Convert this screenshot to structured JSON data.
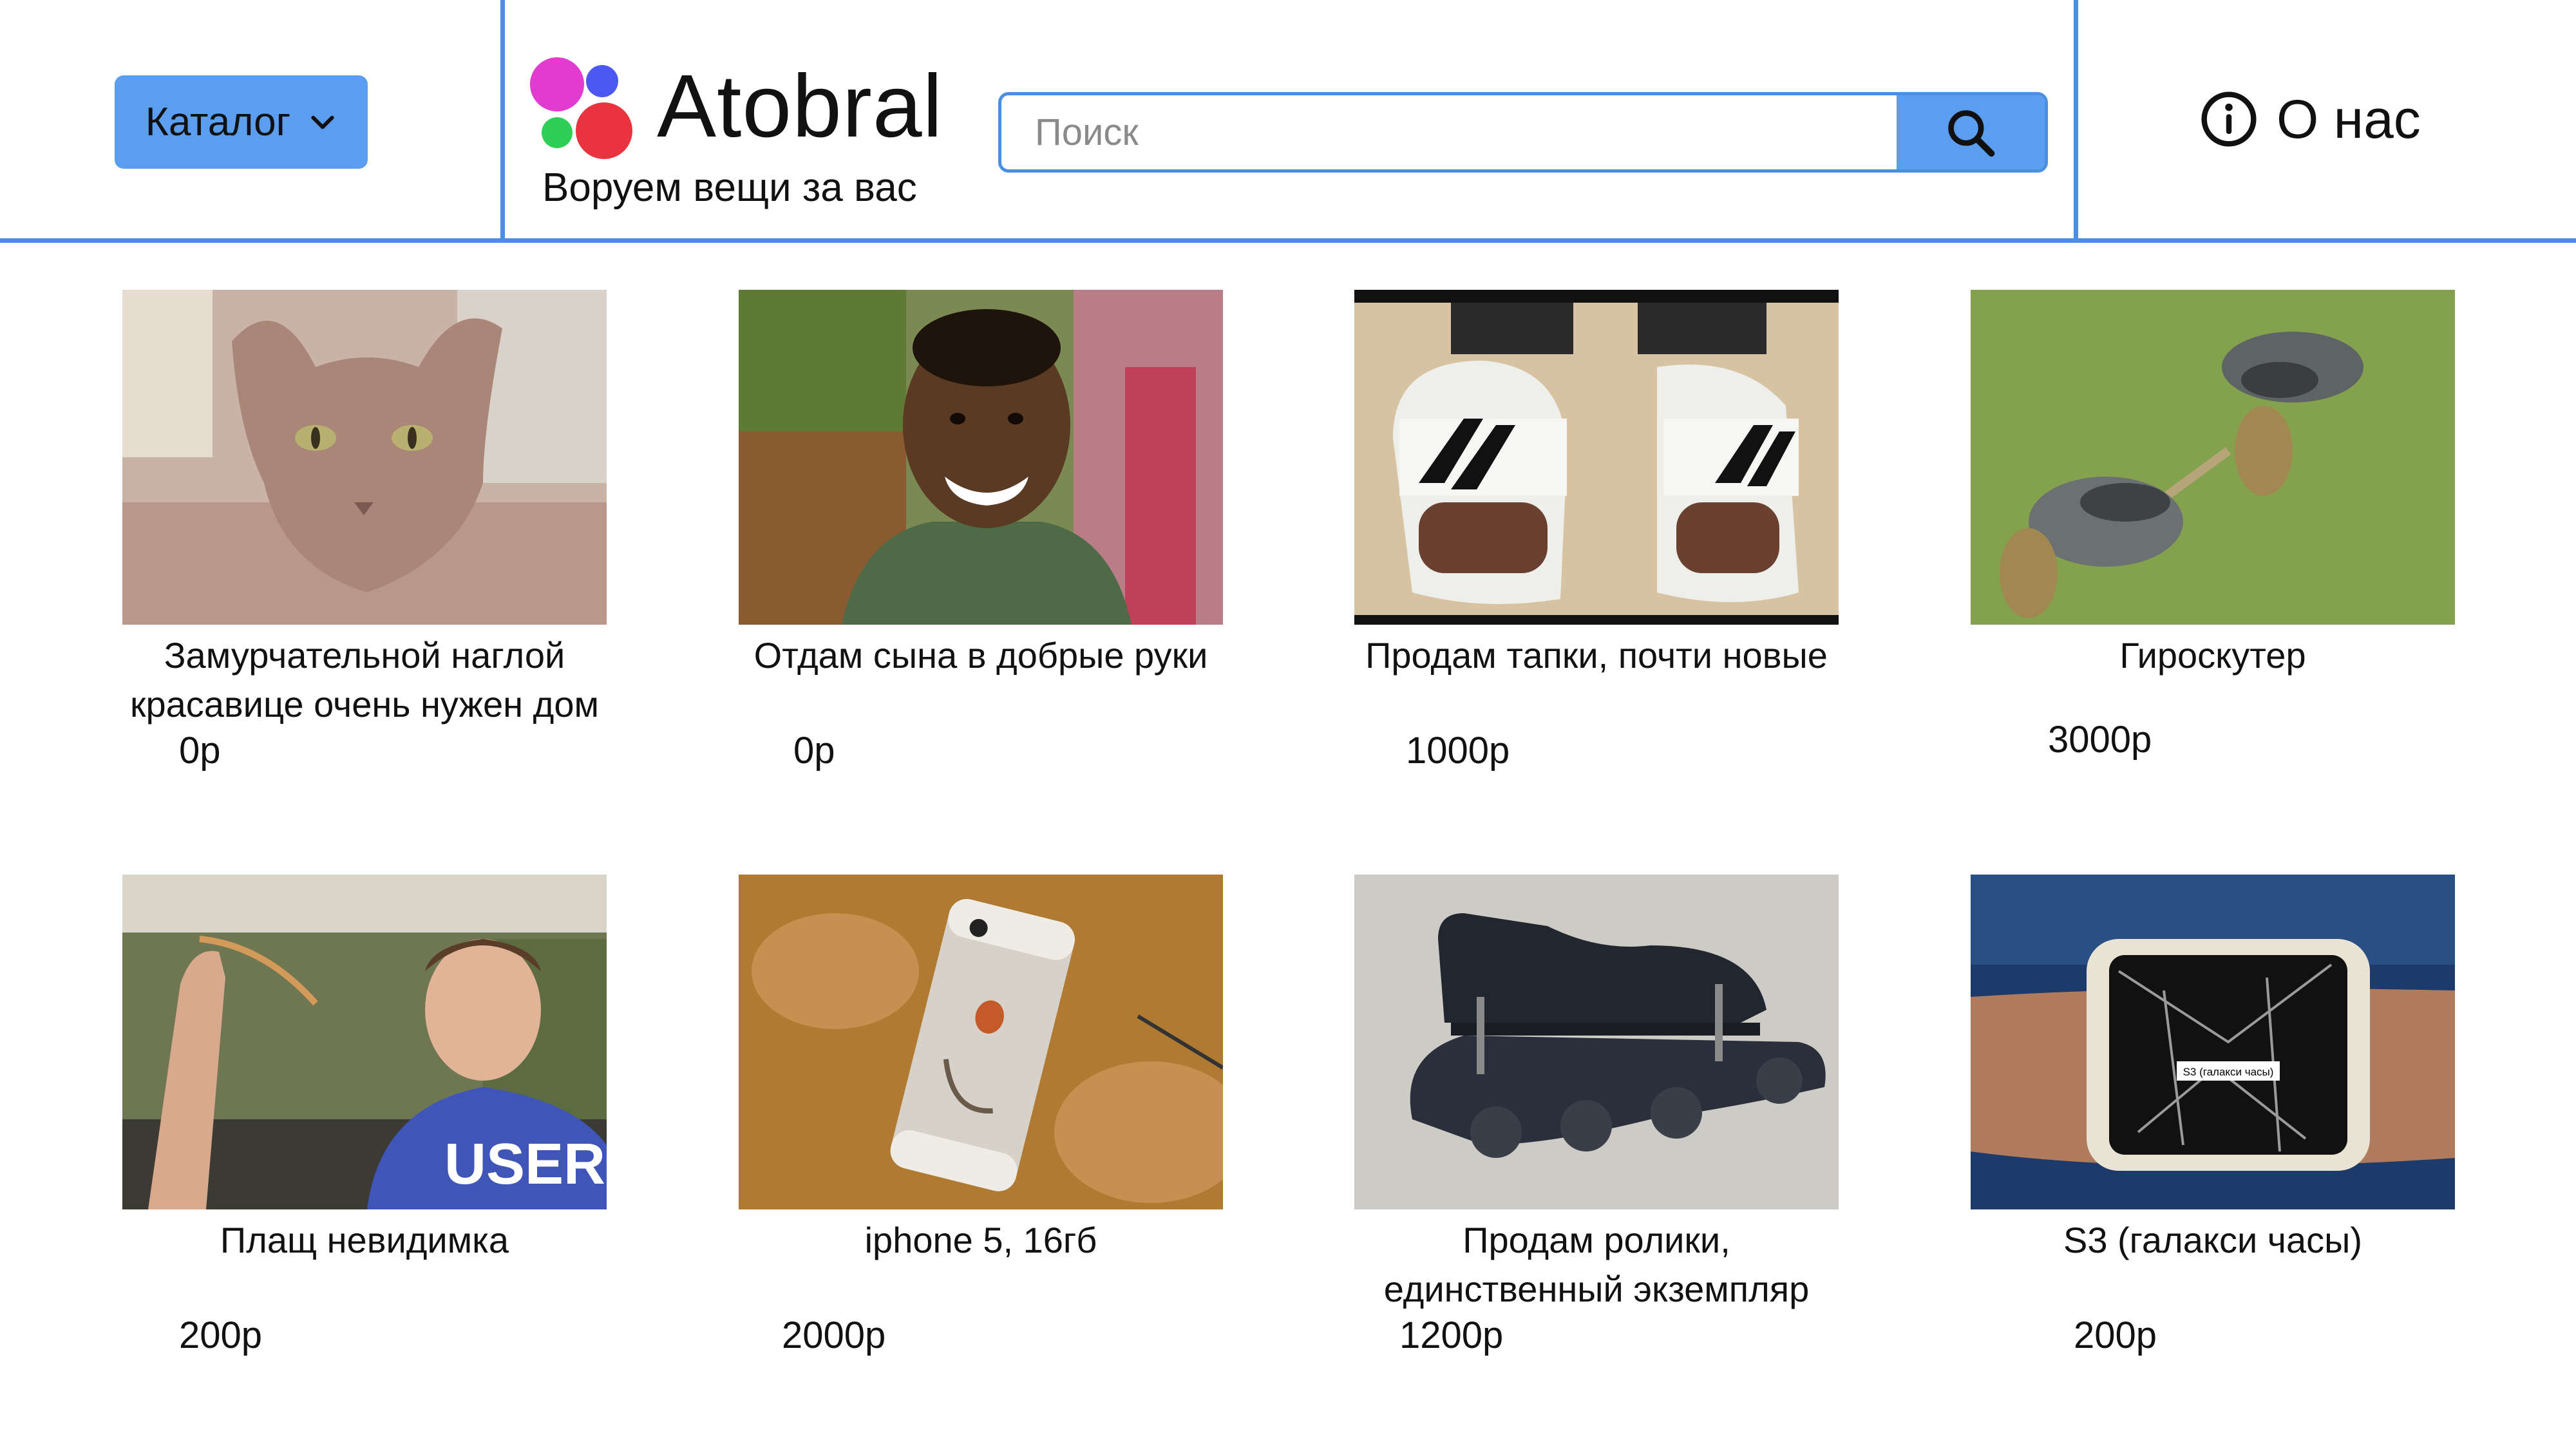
{
  "header": {
    "catalog_label": "Каталог",
    "logo_name": "Atobral",
    "tagline": "Воруем вещи за вас",
    "search_placeholder": "Поиск",
    "about_label": "О нас"
  },
  "colors": {
    "accent": "#5b9def",
    "border": "#4a90e2",
    "logo_magenta": "#e23bd0",
    "logo_blue": "#4b59f0",
    "logo_green": "#2fcf55",
    "logo_red": "#e9343f"
  },
  "products": [
    {
      "title": "Замурчательной наглой красавице очень нужен дом",
      "price": "0р",
      "image": "cat-photo"
    },
    {
      "title": "Отдам сына в добрые руки",
      "price": "0р",
      "image": "smiling-boy-photo"
    },
    {
      "title": "Продам тапки, почти новые",
      "price": "1000р",
      "image": "slippers-photo"
    },
    {
      "title": "Гироскутер",
      "price": "3000р",
      "image": "crocs-scooter-photo"
    },
    {
      "title": "Плащ невидимка",
      "price": "200р",
      "image": "invisible-cloak-photo"
    },
    {
      "title": "iphone 5, 16гб",
      "price": "2000р",
      "image": "broken-iphone-photo"
    },
    {
      "title": "Продам ролики, единственный экземпляр",
      "price": "1200р",
      "image": "shoe-rollers-photo"
    },
    {
      "title": "S3 (галакси часы)",
      "price": "200р",
      "image": "phone-watch-photo"
    }
  ]
}
